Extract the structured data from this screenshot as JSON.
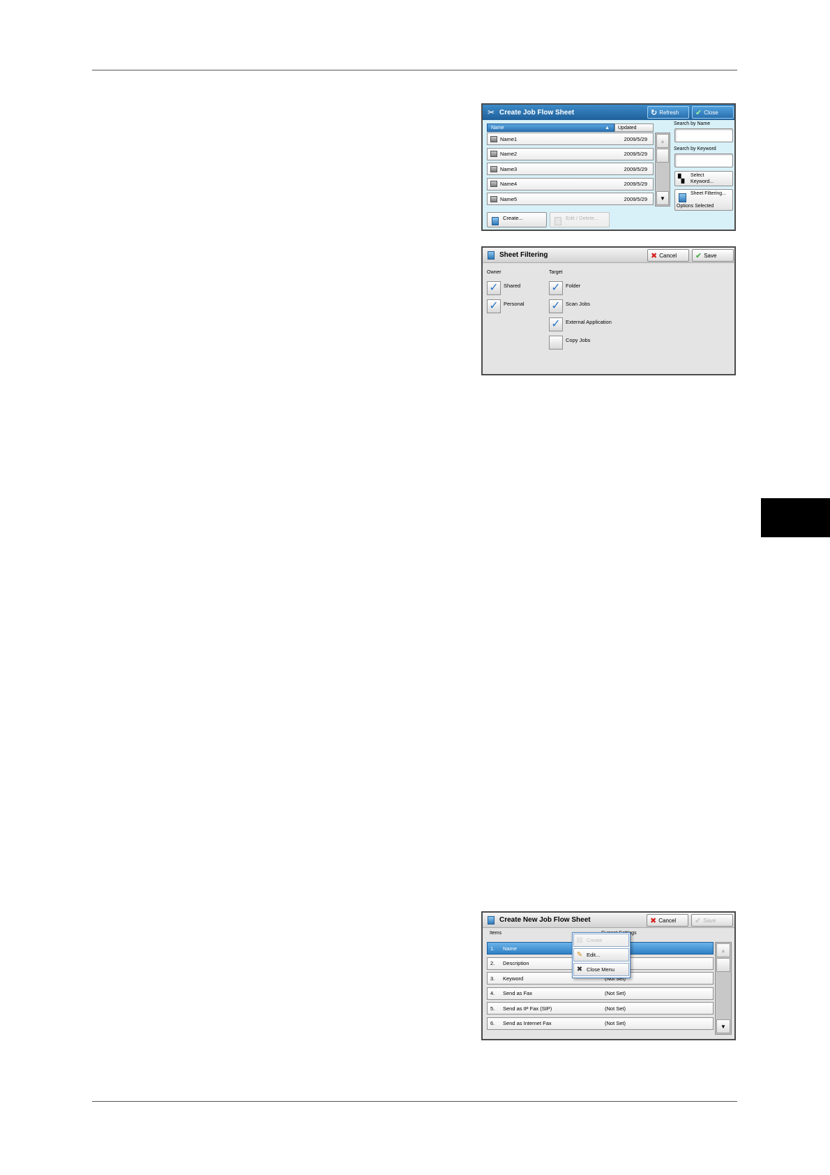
{
  "jobflow": {
    "title": "Create Job Flow Sheet",
    "refresh": "Refresh",
    "close": "Close",
    "col_name": "Name",
    "col_updated": "Updated",
    "rows": [
      {
        "name": "Name1",
        "updated": "2009/5/29"
      },
      {
        "name": "Name2",
        "updated": "2009/5/29"
      },
      {
        "name": "Name3",
        "updated": "2009/5/29"
      },
      {
        "name": "Name4",
        "updated": "2009/5/29"
      },
      {
        "name": "Name5",
        "updated": "2009/5/29"
      }
    ],
    "search_name_label": "Search by Name",
    "search_name_value": "",
    "search_keyword_label": "Search by Keyword",
    "search_keyword_value": "",
    "select_keyword_line1": "Select",
    "select_keyword_line2": "Keyword...",
    "sheet_filtering": "Sheet Filtering...",
    "options_selected": "Options Selected",
    "create": "Create...",
    "edit_delete": "Edit / Delete..."
  },
  "filtering": {
    "title": "Sheet Filtering",
    "cancel": "Cancel",
    "save": "Save",
    "owner_label": "Owner",
    "target_label": "Target",
    "owner": [
      {
        "label": "Shared",
        "checked": true
      },
      {
        "label": "Personal",
        "checked": true
      }
    ],
    "target": [
      {
        "label": "Folder",
        "checked": true
      },
      {
        "label": "Scan Jobs",
        "checked": true
      },
      {
        "label": "External Application",
        "checked": true
      },
      {
        "label": "Copy Jobs",
        "checked": false
      }
    ]
  },
  "newsheet": {
    "title": "Create New Job Flow Sheet",
    "cancel": "Cancel",
    "save": "Save",
    "col_items": "Items",
    "col_settings": "Current Settings",
    "rows": [
      {
        "num": "1.",
        "item": "Name",
        "value": ""
      },
      {
        "num": "2.",
        "item": "Description",
        "value": ""
      },
      {
        "num": "3.",
        "item": "Keyword",
        "value": "(Not Set)"
      },
      {
        "num": "4.",
        "item": "Send as Fax",
        "value": "(Not Set)"
      },
      {
        "num": "5.",
        "item": "Send as IP Fax (SIP)",
        "value": "(Not Set)"
      },
      {
        "num": "6.",
        "item": "Send as Internet Fax",
        "value": "(Not Set)"
      }
    ],
    "menu": [
      "Create",
      "Edit...",
      "Close Menu"
    ]
  },
  "icons": {
    "tools": "tools-icon",
    "refresh": "refresh-icon",
    "check": "check-icon",
    "cancel": "x-icon",
    "sheet": "sheet-icon",
    "binoculars": "binoculars-icon"
  },
  "colors": {
    "title_blue": "#2a6fae",
    "panel_bg_blue": "#d8f0f8",
    "panel_bg_grey": "#e4e4e4",
    "selected_row": "#2f7fc4",
    "check_blue": "#2e74c8",
    "cancel_red": "#d42020",
    "ok_green": "#3aa63a"
  }
}
